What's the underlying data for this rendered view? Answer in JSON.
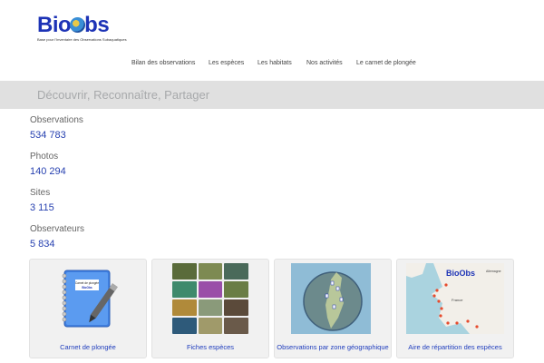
{
  "logo": {
    "prefix": "Bio",
    "suffix": "bs",
    "tagline": "Base pour l'Inventaire des Observations Subaquatiques"
  },
  "nav": {
    "items": [
      {
        "label": "Bilan des observations"
      },
      {
        "label": "Les espèces"
      },
      {
        "label": "Les habitats"
      },
      {
        "label": "Nos activités"
      },
      {
        "label": "Le carnet de plongée"
      }
    ]
  },
  "banner": {
    "text": "Découvrir, Reconnaître, Partager"
  },
  "stats": [
    {
      "label": "Observations",
      "value": "534 783"
    },
    {
      "label": "Photos",
      "value": "140 294"
    },
    {
      "label": "Sites",
      "value": "3 115"
    },
    {
      "label": "Observateurs",
      "value": "5 834"
    }
  ],
  "cards": [
    {
      "label": "Carnet de plongée",
      "icon": "notebook-icon",
      "notebook_title": "Carnet de plongée",
      "notebook_brand": "BioObs"
    },
    {
      "label": "Fiches espèces",
      "icon": "species-photos-icon"
    },
    {
      "label": "Observations par zone géographique",
      "icon": "zone-map-icon"
    },
    {
      "label": "Aire de répartition des espèces",
      "icon": "distribution-map-icon",
      "map_labels": [
        "BioObs",
        "Allemagne",
        "France"
      ]
    }
  ],
  "colors": {
    "brand_blue": "#1d33b6",
    "link_blue": "#2741b0",
    "banner_bg": "#e0e0e0"
  }
}
